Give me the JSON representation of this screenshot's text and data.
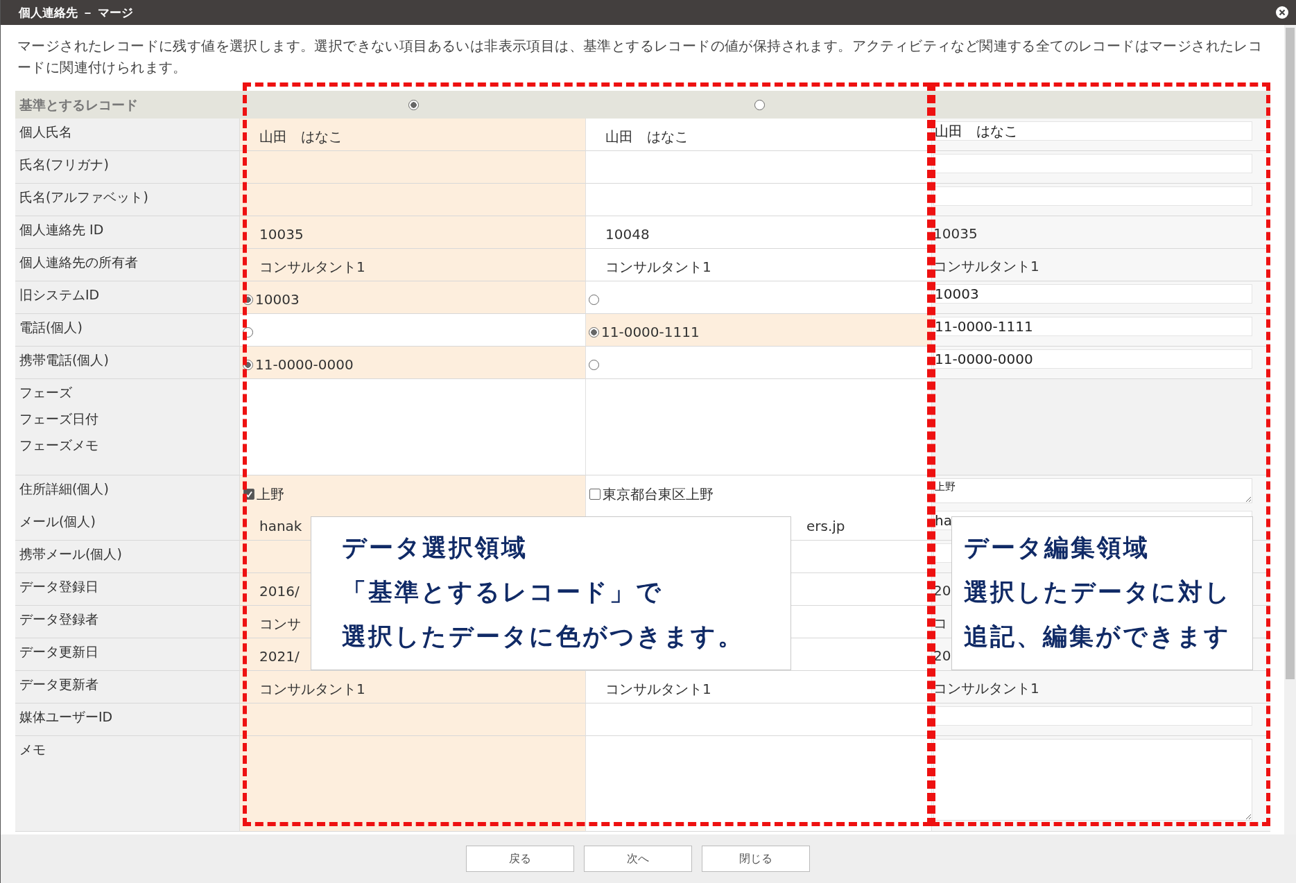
{
  "window": {
    "title": "個人連絡先 － マージ"
  },
  "description": "マージされたレコードに残す値を選択します。選択できない項目あるいは非表示項目は、基準とするレコードの値が保持されます。アクティビティなど関連する全てのレコードはマージされたレコードに関連付けられます。",
  "header": {
    "label": "基準とするレコード",
    "records": [
      {
        "selected": true
      },
      {
        "selected": false
      }
    ]
  },
  "rows": [
    {
      "labels": [
        "個人氏名"
      ],
      "kind": "text",
      "cells": [
        {
          "value": "山田　はなこ",
          "selected": true
        },
        {
          "value": "山田　はなこ",
          "selected": false
        }
      ],
      "edit": {
        "kind": "input",
        "value": "山田　はなこ"
      }
    },
    {
      "labels": [
        "氏名(フリガナ)"
      ],
      "kind": "text",
      "cells": [
        {
          "selected": true
        },
        {
          "selected": false
        }
      ],
      "edit": {
        "kind": "input"
      }
    },
    {
      "labels": [
        "氏名(アルファベット)"
      ],
      "kind": "text",
      "cells": [
        {
          "selected": true
        },
        {
          "selected": false
        }
      ],
      "edit": {
        "kind": "input"
      }
    },
    {
      "labels": [
        "個人連絡先 ID"
      ],
      "kind": "text",
      "cells": [
        {
          "value": "10035",
          "selected": true
        },
        {
          "value": "10048",
          "selected": false
        }
      ],
      "edit": {
        "kind": "readonly",
        "value": "10035"
      }
    },
    {
      "labels": [
        "個人連絡先の所有者"
      ],
      "kind": "text",
      "cells": [
        {
          "value": "コンサルタント1",
          "selected": true
        },
        {
          "value": "コンサルタント1",
          "selected": false
        }
      ],
      "edit": {
        "kind": "readonly",
        "value": "コンサルタント1"
      }
    },
    {
      "labels": [
        "旧システムID"
      ],
      "kind": "radio",
      "cells": [
        {
          "value": "10003",
          "selected": true
        },
        {
          "selected": false
        }
      ],
      "edit": {
        "kind": "input",
        "value": "10003"
      }
    },
    {
      "labels": [
        "電話(個人)"
      ],
      "kind": "radio",
      "cells": [
        {
          "selected": false
        },
        {
          "value": "11-0000-1111",
          "selected": true
        }
      ],
      "edit": {
        "kind": "input",
        "value": "11-0000-1111"
      }
    },
    {
      "labels": [
        "携帯電話(個人)"
      ],
      "kind": "radio",
      "cells": [
        {
          "value": "11-0000-0000",
          "selected": true
        },
        {
          "selected": false
        }
      ],
      "edit": {
        "kind": "input",
        "value": "11-0000-0000"
      }
    },
    {
      "labels": [
        "フェーズ",
        "フェーズ日付",
        "フェーズメモ"
      ],
      "kind": "text",
      "cells": [
        {
          "selected": false
        },
        {
          "selected": false
        }
      ],
      "edit": {
        "kind": "none"
      }
    },
    {
      "labels": [
        "住所詳細(個人)"
      ],
      "kind": "checkbox",
      "cells": [
        {
          "value": "上野",
          "selected": true
        },
        {
          "value": "東京都台東区上野",
          "selected": false
        }
      ],
      "edit": {
        "kind": "textarea",
        "value": "上野"
      }
    },
    {
      "labels": [
        "メール(個人)"
      ],
      "kind": "text",
      "cells": [
        {
          "value": "hanak",
          "selected": true
        },
        {
          "value": "ers.jp",
          "selected": false,
          "clipped": true
        }
      ],
      "edit": {
        "kind": "input",
        "value": "ha"
      }
    },
    {
      "labels": [
        "携帯メール(個人)"
      ],
      "kind": "text",
      "cells": [
        {
          "selected": true
        },
        {
          "selected": false
        }
      ],
      "edit": {
        "kind": "input"
      }
    },
    {
      "labels": [
        "データ登録日"
      ],
      "kind": "text",
      "cells": [
        {
          "value": "2016/",
          "selected": true
        },
        {
          "selected": false
        }
      ],
      "edit": {
        "kind": "readonly",
        "value": "20"
      }
    },
    {
      "labels": [
        "データ登録者"
      ],
      "kind": "text",
      "cells": [
        {
          "value": "コンサ",
          "selected": true
        },
        {
          "selected": false
        }
      ],
      "edit": {
        "kind": "readonly",
        "value": "コ"
      }
    },
    {
      "labels": [
        "データ更新日"
      ],
      "kind": "text",
      "cells": [
        {
          "value": "2021/",
          "selected": true
        },
        {
          "selected": false
        }
      ],
      "edit": {
        "kind": "readonly",
        "value": "20"
      }
    },
    {
      "labels": [
        "データ更新者"
      ],
      "kind": "text",
      "cells": [
        {
          "value": "コンサルタント1",
          "selected": true
        },
        {
          "value": "コンサルタント1",
          "selected": false
        }
      ],
      "edit": {
        "kind": "readonly",
        "value": "コンサルタント1"
      }
    },
    {
      "labels": [
        "媒体ユーザーID"
      ],
      "kind": "text",
      "cells": [
        {
          "selected": true
        },
        {
          "selected": false
        }
      ],
      "edit": {
        "kind": "input"
      }
    },
    {
      "labels": [
        "メモ"
      ],
      "kind": "text",
      "cells": [
        {
          "selected": true
        },
        {
          "selected": false
        }
      ],
      "edit": {
        "kind": "textarea"
      }
    }
  ],
  "callouts": [
    {
      "lines": [
        "データ選択領域",
        "「基準とするレコード」で",
        "選択したデータに色がつきます。"
      ]
    },
    {
      "lines": [
        "データ編集領域",
        "選択したデータに対し",
        "追記、編集ができます"
      ]
    }
  ],
  "buttons": [
    "戻る",
    "次へ",
    "閉じる"
  ]
}
